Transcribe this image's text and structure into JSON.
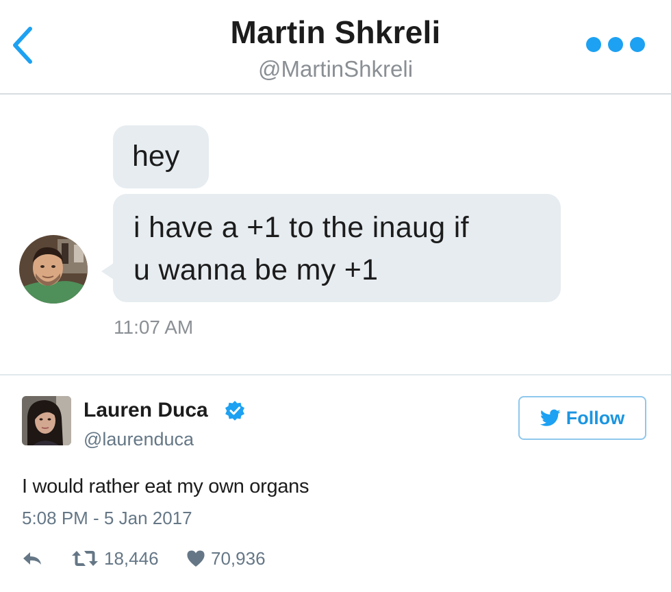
{
  "header": {
    "title": "Martin Shkreli",
    "handle": "@MartinShkreli",
    "back_icon": "chevron-left-icon",
    "more_icon": "ellipsis-icon"
  },
  "conversation": {
    "messages": [
      {
        "lines": [
          "hey"
        ]
      },
      {
        "lines": [
          "i have a +1 to the inaug if",
          "u wanna be my +1"
        ]
      }
    ],
    "timestamp": "11:07 AM"
  },
  "tweet": {
    "author_name": "Lauren Duca",
    "author_handle": "@laurenduca",
    "verified": true,
    "follow_label": "Follow",
    "text": "I would rather eat my own organs",
    "timestamp": "5:08 PM - 5 Jan 2017",
    "retweet_count": "18,446",
    "like_count": "70,936"
  },
  "colors": {
    "accent": "#1da1f2",
    "bubble": "#e6ecf0",
    "secondary_text": "#657786"
  }
}
